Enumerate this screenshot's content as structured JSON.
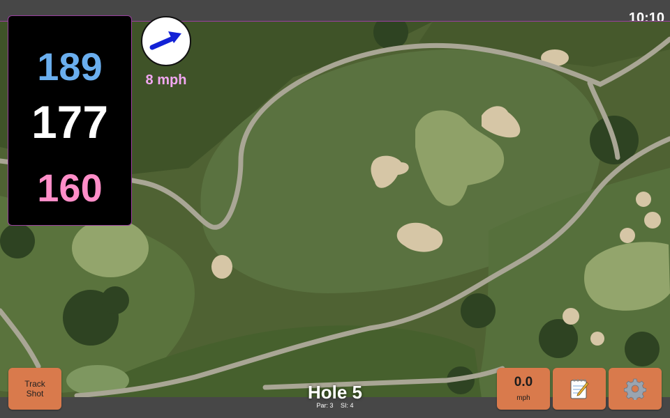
{
  "status_bar": {
    "time": "10:10"
  },
  "distances": {
    "back": "189",
    "middle": "177",
    "front": "160"
  },
  "wind": {
    "speed": "8 mph",
    "icon": "wind-arrow-icon"
  },
  "hole": {
    "title": "Hole 5",
    "par": "Par: 3",
    "stroke_index": "SI: 4"
  },
  "buttons": {
    "track_line1": "Track",
    "track_line2": "Shot",
    "speed_value": "0.0",
    "speed_unit": "mph",
    "notes_icon": "notepad-icon",
    "settings_icon": "gear-icon"
  },
  "colors": {
    "back": "#6aaeee",
    "middle": "#ffffff",
    "front": "#ff8ec8",
    "wind_text": "#f2a7f2",
    "button": "#d97a4c",
    "map_border": "#9b3fa0"
  }
}
